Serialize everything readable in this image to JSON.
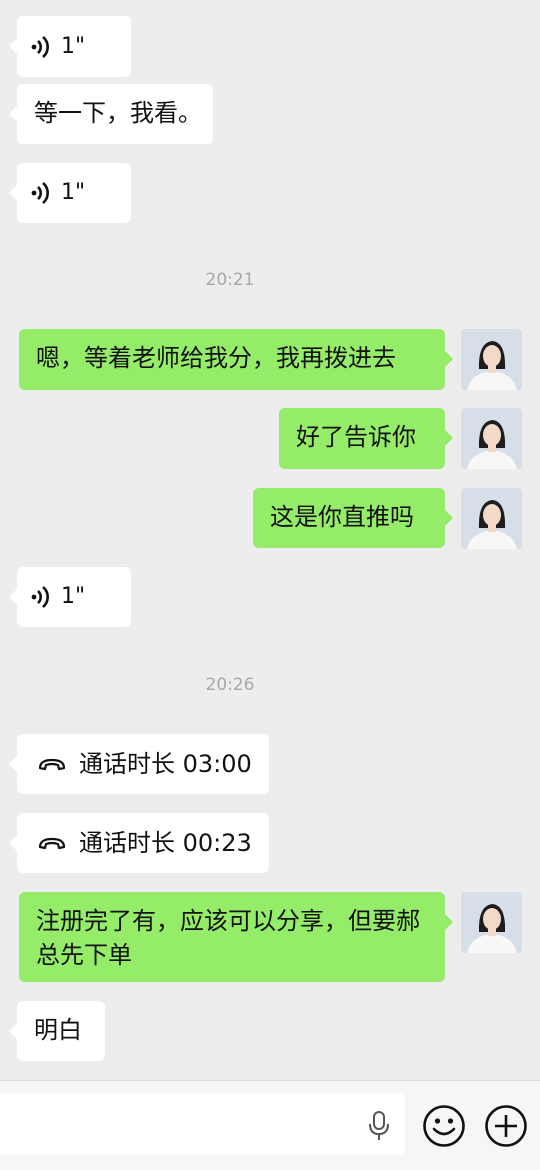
{
  "messages": {
    "voice1": {
      "duration": "1\""
    },
    "text1": "等一下，我看。",
    "voice2": {
      "duration": "1\""
    },
    "time1": "20:21",
    "text2": "嗯，等着老师给我分，我再拨进去",
    "text3": "好了告诉你",
    "text4": "这是你直推吗",
    "voice3": {
      "duration": "1\""
    },
    "time2": "20:26",
    "call1": "通话时长 03:00",
    "call2": "通话时长 00:23",
    "text5": "注册完了有，应该可以分享，但要郝总先下单",
    "text6": "明白"
  },
  "icons": {
    "voice": "voice-wave-icon",
    "call": "phone-hangup-icon",
    "mic": "microphone-icon",
    "emoji": "emoji-icon",
    "plus": "plus-icon"
  },
  "colors": {
    "background": "#ededed",
    "incoming": "#ffffff",
    "outgoing": "#95ec69",
    "timestamp": "#a8a8a8"
  }
}
